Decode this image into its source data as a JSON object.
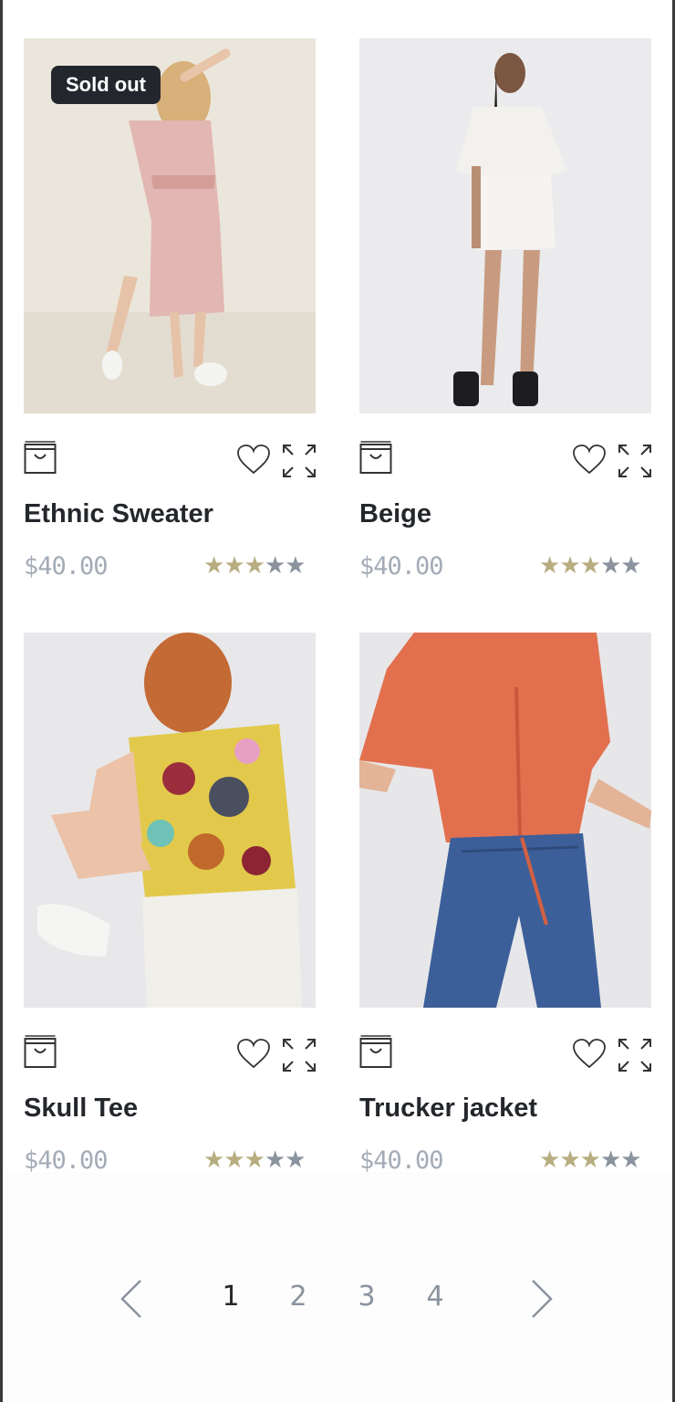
{
  "products": [
    {
      "title": "Ethnic Sweater",
      "price": "$40.00",
      "badge": "Sold out",
      "rating": 3,
      "max_rating": 5
    },
    {
      "title": "Beige",
      "price": "$40.00",
      "badge": "",
      "rating": 3,
      "max_rating": 5
    },
    {
      "title": "Skull Tee",
      "price": "$40.00",
      "badge": "",
      "rating": 3,
      "max_rating": 5
    },
    {
      "title": "Trucker jacket",
      "price": "$40.00",
      "badge": "",
      "rating": 3,
      "max_rating": 5
    }
  ],
  "icons": {
    "cart": "shopping-bag-icon",
    "wishlist": "heart-icon",
    "quick_view": "expand-icon",
    "prev": "chevron-left-icon",
    "next": "chevron-right-icon"
  },
  "pagination": {
    "pages": [
      "1",
      "2",
      "3",
      "4"
    ],
    "current": "1"
  },
  "colors": {
    "badge_bg": "#23272d",
    "star_filled": "#b8ad80",
    "star_empty": "#8a939e",
    "price": "#a3acb6",
    "title": "#24272b"
  }
}
